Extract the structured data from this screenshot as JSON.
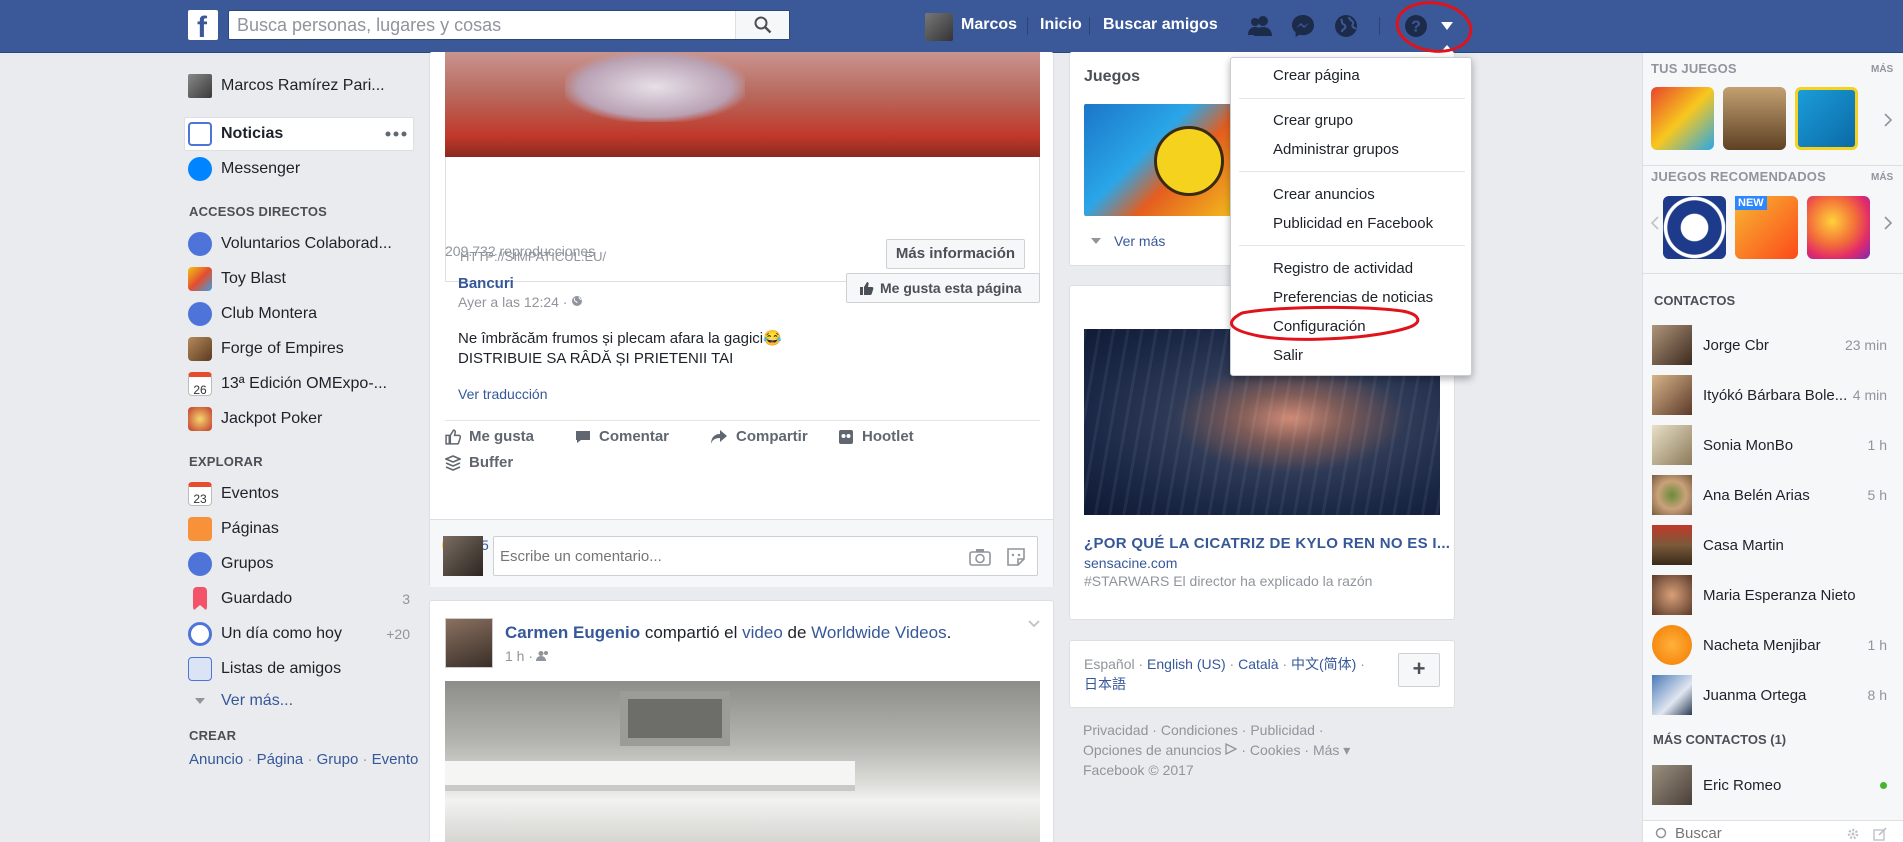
{
  "topbar": {
    "logo": "f",
    "search_placeholder": "Busca personas, lugares y cosas",
    "user_name": "Marcos",
    "home": "Inicio",
    "find_friends": "Buscar amigos"
  },
  "left_nav": {
    "profile": "Marcos Ramírez Pari...",
    "news": "Noticias",
    "messenger": "Messenger",
    "shortcuts_title": "ACCESOS DIRECTOS",
    "shortcuts": [
      "Voluntarios Colaborad...",
      "Toy Blast",
      "Club Montera",
      "Forge of Empires",
      "13ª Edición OMExpo-...",
      "Jackpot Poker"
    ],
    "calendar_day_1": "26",
    "explore_title": "EXPLORAR",
    "explore": [
      {
        "label": "Eventos",
        "count": ""
      },
      {
        "label": "Páginas",
        "count": ""
      },
      {
        "label": "Grupos",
        "count": ""
      },
      {
        "label": "Guardado",
        "count": "3"
      },
      {
        "label": "Un día como hoy",
        "count": "+20"
      },
      {
        "label": "Listas de amigos",
        "count": ""
      }
    ],
    "calendar_day_2": "23",
    "see_more": "Ver más...",
    "create_title": "CREAR",
    "create_links": [
      "Anuncio",
      "Página",
      "Grupo",
      "Evento"
    ],
    "sep": "·"
  },
  "post1": {
    "link_url": "HTTP://SIMPATICUL.EU/",
    "more_info": "Más información",
    "views": "209.732 reproducciones",
    "author": "Bancuri",
    "time": "Ayer a las 12:24 · ",
    "like_page": "Me gusta esta página",
    "text_line1": "Ne îmbrăcăm frumos și plecam afara la gagici😂",
    "text_line2": "DISTRIBUIE SA RÂDĂ ȘI PRIETENII TAI",
    "translate": "Ver traducción",
    "actions": [
      "Me gusta",
      "Comentar",
      "Compartir",
      "Hootlet",
      "Buffer"
    ],
    "reactions_count": "5",
    "comment_placeholder": "Escribe un comentario..."
  },
  "post2": {
    "author": "Carmen Eugenio",
    "shared": " compartió el ",
    "video": "video",
    "of": " de ",
    "page": "Worldwide Videos",
    "dot": ".",
    "time": "1 h · "
  },
  "middle": {
    "games_title": "Juegos",
    "see_more": "Ver más",
    "article_title": "¿POR QUÉ LA CICATRIZ DE KYLO REN NO ES I...",
    "article_source": "sensacine.com",
    "article_desc": "#STARWARS El director ha explicado la razón",
    "languages": [
      "Español",
      "English (US)",
      "Català",
      "中文(简体)",
      "日本語"
    ],
    "lang_plus": "+",
    "footer_line1": [
      "Privacidad",
      "Condiciones",
      "Publicidad"
    ],
    "footer_line2": [
      "Opciones de anuncios",
      "Cookies",
      "Más ▾"
    ],
    "copyright": "Facebook © 2017",
    "sep": " · "
  },
  "menu": {
    "groups": [
      [
        "Crear página"
      ],
      [
        "Crear grupo",
        "Administrar grupos"
      ],
      [
        "Crear anuncios",
        "Publicidad en Facebook"
      ],
      [
        "Registro de actividad",
        "Preferencias de noticias",
        "Configuración",
        "Salir"
      ]
    ]
  },
  "right": {
    "your_games": "TUS JUEGOS",
    "more": "MÁS",
    "recommended": "JUEGOS RECOMENDADOS",
    "new_badge": "NEW",
    "contacts_title": "CONTACTOS",
    "contacts": [
      {
        "name": "Jorge Cbr",
        "time": "23 min"
      },
      {
        "name": "Ityókó Bárbara Bole...",
        "time": "4 min"
      },
      {
        "name": "Sonia MonBo",
        "time": "1 h"
      },
      {
        "name": "Ana Belén Arias",
        "time": "5 h"
      },
      {
        "name": "Casa Martin",
        "time": ""
      },
      {
        "name": "Maria Esperanza Nieto",
        "time": ""
      },
      {
        "name": "Nacheta Menjibar",
        "time": "1 h"
      },
      {
        "name": "Juanma Ortega",
        "time": "8 h"
      }
    ],
    "more_contacts": "MÁS CONTACTOS (1)",
    "extra_contact": "Eric Romeo",
    "search_placeholder": "Buscar"
  },
  "colors": {
    "brand": "#3b5998",
    "link": "#365899",
    "annotation": "#e0131c"
  }
}
